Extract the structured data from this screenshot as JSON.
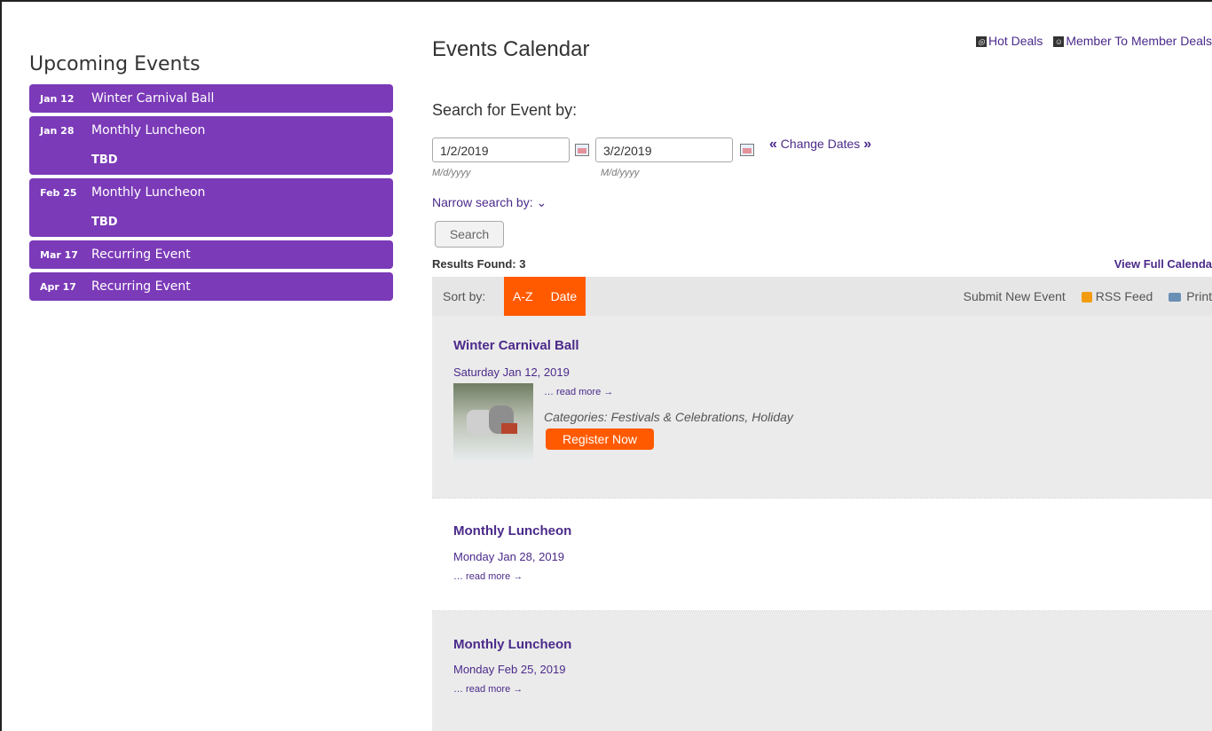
{
  "sidebar": {
    "heading": "Upcoming Events",
    "items": [
      {
        "date": "Jan 12",
        "title": "Winter Carnival Ball",
        "sub": ""
      },
      {
        "date": "Jan 28",
        "title": "Monthly Luncheon",
        "sub": "TBD"
      },
      {
        "date": "Feb 25",
        "title": "Monthly Luncheon",
        "sub": "TBD"
      },
      {
        "date": "Mar 17",
        "title": "Recurring Event",
        "sub": ""
      },
      {
        "date": "Apr 17",
        "title": "Recurring Event",
        "sub": ""
      }
    ]
  },
  "header": {
    "title": "Events Calendar",
    "hot_deals": "Hot Deals",
    "member_deals": "Member To Member Deals"
  },
  "search": {
    "label": "Search for Event by:",
    "start_date": "1/2/2019",
    "end_date": "3/2/2019",
    "format": "M/d/yyyy",
    "change_dates": "Change Dates",
    "narrow": "Narrow search by:",
    "button": "Search"
  },
  "results": {
    "found": "Results Found: 3",
    "full_calendar": "View Full Calenda"
  },
  "toolbar": {
    "sort_by": "Sort by:",
    "sort_az": "A-Z",
    "sort_date": "Date",
    "submit": "Submit New Event",
    "rss": "RSS Feed",
    "print": "Print"
  },
  "events": [
    {
      "title": "Winter Carnival Ball",
      "date": "Saturday Jan 12, 2019",
      "read_more": "… read more →",
      "categories": "Categories: Festivals & Celebrations, Holiday",
      "register": "Register Now"
    },
    {
      "title": "Monthly Luncheon",
      "date": "Monday Jan 28, 2019",
      "read_more": "… read more →"
    },
    {
      "title": "Monthly Luncheon",
      "date": "Monday Feb 25, 2019",
      "read_more": "… read more →"
    }
  ]
}
